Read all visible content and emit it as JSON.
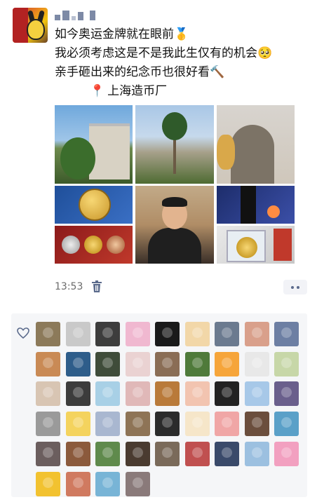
{
  "post": {
    "text_lines": [
      "如今奥运金牌就在眼前🥇",
      "我必须考虑这是不是我此生仅有的机会🥺",
      "亲手砸出来的纪念币也很好看🔨",
      "上海造币厂"
    ],
    "location_icon": "location-pin-icon",
    "timestamp": "13:53"
  },
  "photos": [
    {
      "name": "building-with-tree"
    },
    {
      "name": "palm-courtyard"
    },
    {
      "name": "stone-arch-gate"
    },
    {
      "name": "gold-medal-collage"
    },
    {
      "name": "man-thumbs-up"
    },
    {
      "name": "coin-striking-collage"
    }
  ],
  "actions": {
    "delete_icon": "trash-icon",
    "more_icon": "more-dots-icon"
  },
  "likes": {
    "like_icon": "heart-icon",
    "avatar_colors": [
      "#8c7a5a",
      "#c9c9c9",
      "#3d3d3d",
      "#f0b8d0",
      "#1a1a1a",
      "#f2d7a8",
      "#6b7a8f",
      "#d9a08b",
      "#6d7fa3",
      "#c98a55",
      "#2e5d8a",
      "#3f4c3a",
      "#ead2d2",
      "#8a6d55",
      "#4f7a3a",
      "#f6a53a",
      "#e8e8e8",
      "#c7d7a8",
      "#d8c5b3",
      "#3c3c3c",
      "#a8d0e6",
      "#e0b8b8",
      "#b97a3a",
      "#f2c4b0",
      "#222222",
      "#a7c8e8",
      "#6a5f8c",
      "#9a9a9a",
      "#f4d35e",
      "#a9b7d0",
      "#8e7456",
      "#2b2b2b",
      "#f6e6c9",
      "#f0a6a6",
      "#6b4e3d",
      "#5aa0c8",
      "#6b5e5e",
      "#8b5a3c",
      "#5f8a4c",
      "#4a3b30",
      "#7a6a5a",
      "#c05050",
      "#3a4a6a",
      "#9cc0e0",
      "#f2a0c0",
      "#f2c230",
      "#d07a60",
      "#78b4d6",
      "#8a7a7a"
    ]
  }
}
